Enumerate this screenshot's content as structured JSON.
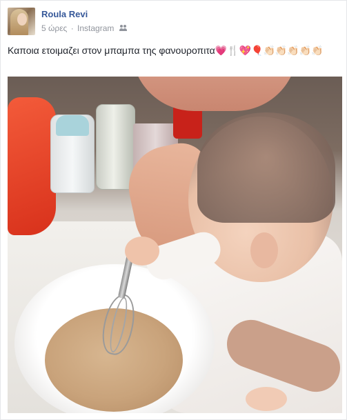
{
  "post": {
    "author": "Roula Revi",
    "time": "5 ώρες",
    "separator": "·",
    "source": "Instagram",
    "audience_icon": "friends-icon",
    "text": "Καποια ετοιμαζει στον μπαμπα της φανουροπιτα💗🍴💖🎈👏🏻👏🏻👏🏻👏🏻👏🏻"
  },
  "colors": {
    "author_link": "#365899",
    "meta_text": "#90949c",
    "body_text": "#1d2129",
    "border": "#e5e6e9"
  }
}
